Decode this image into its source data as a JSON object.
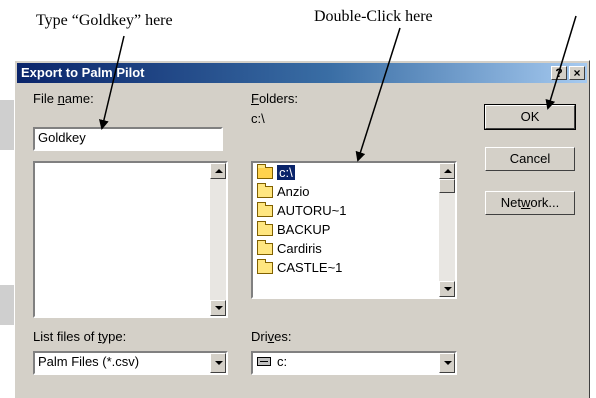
{
  "annotations": {
    "type_here": "Type “Goldkey” here",
    "double_click": "Double-Click here"
  },
  "dialog": {
    "title": "Export to Palm Pilot",
    "help_btn": "?",
    "close_btn": "×"
  },
  "file_name": {
    "label_pre": "File ",
    "label_u": "n",
    "label_post": "ame:",
    "value": "Goldkey"
  },
  "folders": {
    "label_u": "F",
    "label_post": "olders:",
    "current_path": "c:\\",
    "items": [
      {
        "name": "c:\\",
        "icon": "open-folder-icon",
        "selected": true
      },
      {
        "name": "Anzio",
        "icon": "folder-icon",
        "selected": false
      },
      {
        "name": "AUTORU~1",
        "icon": "folder-icon",
        "selected": false
      },
      {
        "name": "BACKUP",
        "icon": "folder-icon",
        "selected": false
      },
      {
        "name": "Cardiris",
        "icon": "folder-icon",
        "selected": false
      },
      {
        "name": "CASTLE~1",
        "icon": "folder-icon",
        "selected": false
      }
    ]
  },
  "buttons": {
    "ok": "OK",
    "cancel": "Cancel",
    "network_pre": "Net",
    "network_u": "w",
    "network_post": "ork..."
  },
  "file_type": {
    "label_pre": "List files of ",
    "label_u": "t",
    "label_post": "ype:",
    "value": "Palm Files (*.csv)"
  },
  "drives": {
    "label_pre": "Dri",
    "label_u": "v",
    "label_post": "es:",
    "value": "c:"
  },
  "colors": {
    "titlebar_start": "#0a246a",
    "titlebar_end": "#a6caf0",
    "face": "#d4d0c8",
    "selection": "#0a246a"
  }
}
